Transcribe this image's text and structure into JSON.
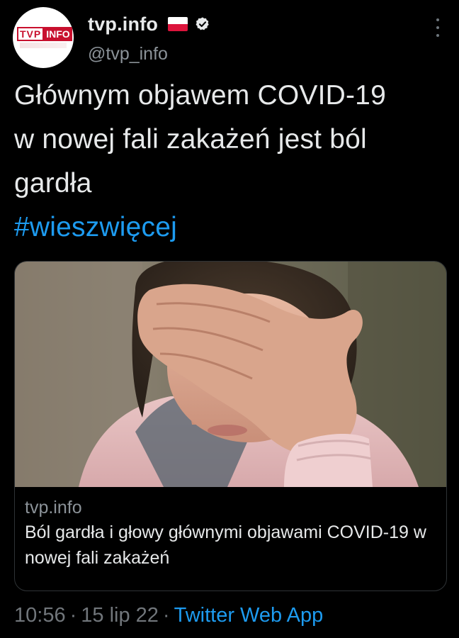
{
  "author": {
    "display_name": "tvp.info",
    "handle": "@tvp_info",
    "avatar_logo_left": "TVP",
    "avatar_logo_right": "INFO",
    "flag_icon": "poland-flag-icon",
    "verified_icon": "verified-badge-icon"
  },
  "tweet": {
    "lines": [
      "Głównym objawem COVID-19",
      "w nowej fali zakażeń jest ból",
      "gardła"
    ],
    "hashtag": "#wieszwięcej"
  },
  "card": {
    "domain": "tvp.info",
    "title": "Ból gardła i głowy głównymi objawami COVID-19 w nowej fali zakażeń"
  },
  "footer": {
    "time": "10:56",
    "separator": "·",
    "date": "15 lip 22",
    "source": "Twitter Web App"
  },
  "colors": {
    "background": "#000000",
    "text": "#e7e9ea",
    "muted": "#71767b",
    "link": "#1d9bf0",
    "brand_red": "#c8102e"
  }
}
